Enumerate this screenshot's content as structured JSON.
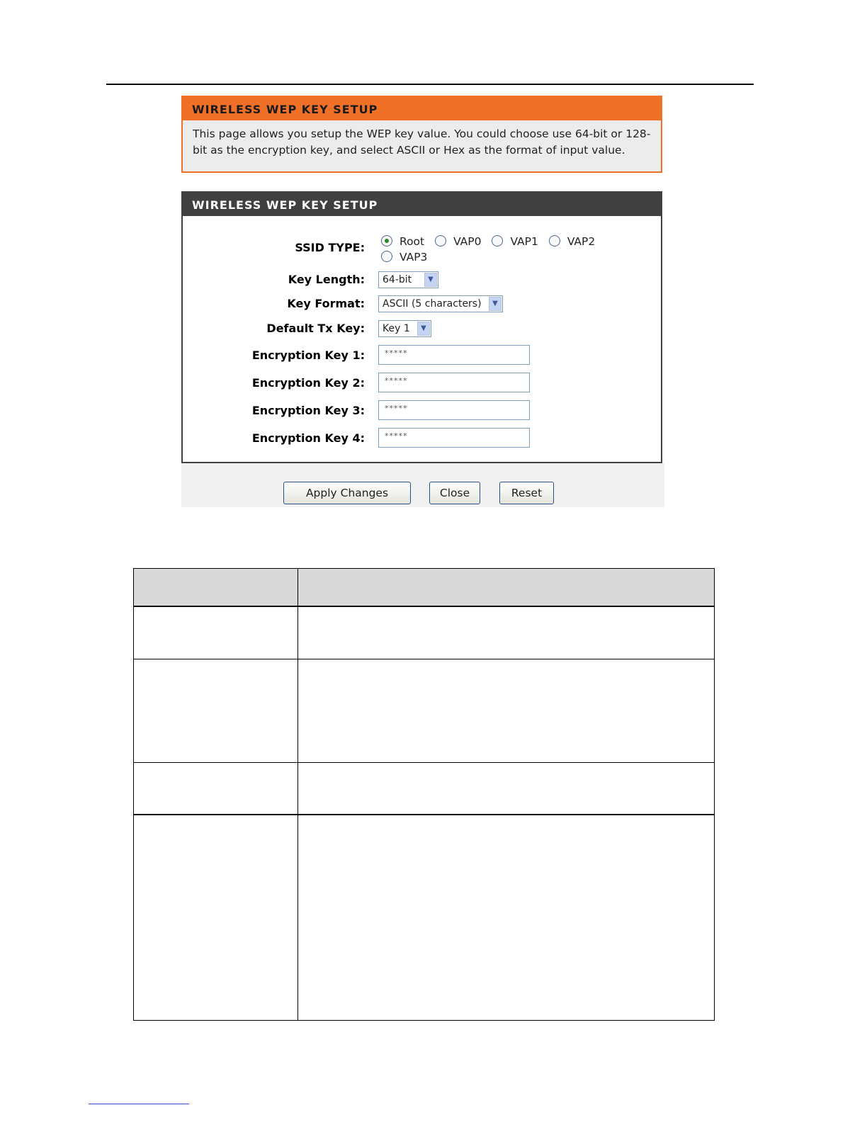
{
  "info_panel": {
    "title": "WIRELESS WEP KEY SETUP",
    "description": "This page allows you setup the WEP key value. You could choose use 64-bit or 128-bit as the encryption key, and select ASCII or Hex as the format of input value."
  },
  "setup_panel": {
    "title": "WIRELESS WEP KEY SETUP",
    "ssid_type": {
      "label": "SSID TYPE:",
      "options": [
        "Root",
        "VAP0",
        "VAP1",
        "VAP2",
        "VAP3"
      ],
      "selected": "Root"
    },
    "key_length": {
      "label": "Key Length:",
      "value": "64-bit"
    },
    "key_format": {
      "label": "Key Format:",
      "value": "ASCII (5 characters)"
    },
    "default_tx_key": {
      "label": "Default Tx Key:",
      "value": "Key 1"
    },
    "encryption_keys": [
      {
        "label": "Encryption Key 1:",
        "value": "*****"
      },
      {
        "label": "Encryption Key 2:",
        "value": "*****"
      },
      {
        "label": "Encryption Key 3:",
        "value": "*****"
      },
      {
        "label": "Encryption Key 4:",
        "value": "*****"
      }
    ]
  },
  "buttons": {
    "apply": "Apply Changes",
    "close": "Close",
    "reset": "Reset"
  },
  "colors": {
    "accent_orange": "#f07028",
    "dark_header": "#404040"
  }
}
